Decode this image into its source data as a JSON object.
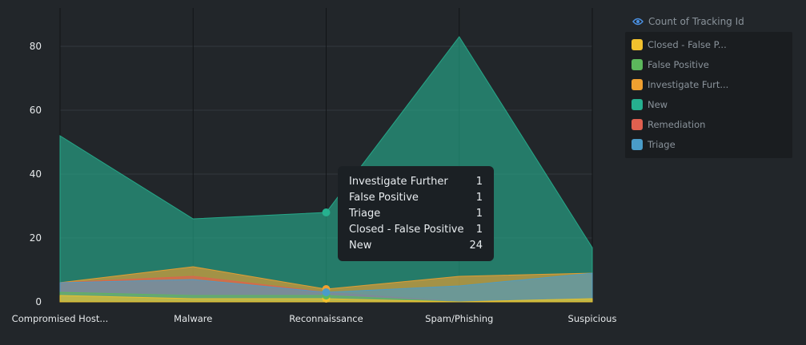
{
  "legend": {
    "title": "Count of Tracking Id",
    "icon": "eye-icon",
    "items": [
      {
        "label": "Closed - False P...",
        "color": "#f2c12e"
      },
      {
        "label": "False Positive",
        "color": "#5cb85c"
      },
      {
        "label": "Investigate Furt...",
        "color": "#f0a030"
      },
      {
        "label": "New",
        "color": "#26b08f"
      },
      {
        "label": "Remediation",
        "color": "#e0604f"
      },
      {
        "label": "Triage",
        "color": "#4a9cc8"
      }
    ]
  },
  "tooltip": {
    "rows": [
      {
        "label": "Investigate Further",
        "value": "1"
      },
      {
        "label": "False Positive",
        "value": "1"
      },
      {
        "label": "Triage",
        "value": "1"
      },
      {
        "label": "Closed - False Positive",
        "value": "1"
      },
      {
        "label": "New",
        "value": "24"
      }
    ]
  },
  "chart_data": {
    "type": "area",
    "categories": [
      "Compromised Host...",
      "Malware",
      "Reconnaissance",
      "Spam/Phishing",
      "Suspicious"
    ],
    "ylim": [
      0,
      90
    ],
    "yticks": [
      0,
      20,
      40,
      60,
      80
    ],
    "grid": true,
    "legend_position": "right",
    "highlight_category": "Reconnaissance",
    "series": [
      {
        "name": "New",
        "color": "#26b08f",
        "values": [
          52,
          26,
          28,
          83,
          17
        ]
      },
      {
        "name": "Investigate Further",
        "color": "#f0a030",
        "values": [
          6,
          11,
          4,
          8,
          9
        ]
      },
      {
        "name": "Remediation",
        "color": "#e0604f",
        "values": [
          6,
          8,
          3,
          0,
          1
        ]
      },
      {
        "name": "Triage",
        "color": "#4a9cc8",
        "values": [
          6,
          7,
          3,
          5,
          9
        ]
      },
      {
        "name": "False Positive",
        "color": "#5cb85c",
        "values": [
          3,
          2,
          2,
          0,
          1
        ]
      },
      {
        "name": "Closed - False Positive",
        "color": "#f2c12e",
        "values": [
          2,
          1,
          1,
          0,
          1
        ]
      }
    ]
  }
}
